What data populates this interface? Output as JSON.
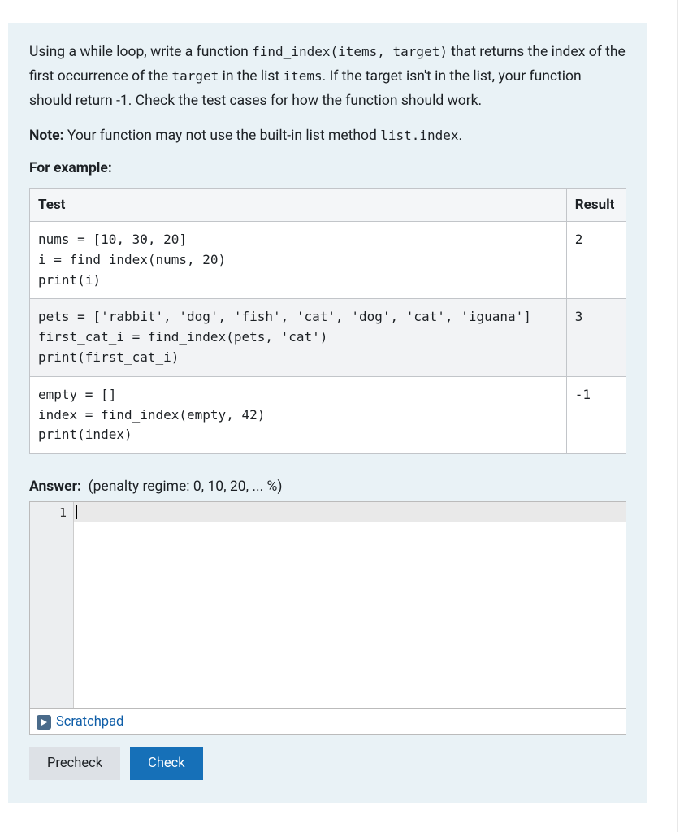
{
  "question": {
    "text_before_code1": "Using a while loop, write a function ",
    "code1": "find_index(items, target)",
    "text_mid1": " that returns the index of the first occurrence of the ",
    "code2": "target",
    "text_mid2": " in the list ",
    "code3": "items",
    "text_after": ". If the target isn't in the list, your function should return -1. Check the test cases for how the function should work."
  },
  "note": {
    "label": "Note:",
    "text_before": " Your function may not use the built-in list method ",
    "code": "list.index",
    "text_after": "."
  },
  "example_label": "For example:",
  "table": {
    "headers": {
      "test": "Test",
      "result": "Result"
    },
    "rows": [
      {
        "test": "nums = [10, 30, 20]\ni = find_index(nums, 20)\nprint(i)",
        "result": "2"
      },
      {
        "test": "pets = ['rabbit', 'dog', 'fish', 'cat', 'dog', 'cat', 'iguana']\nfirst_cat_i = find_index(pets, 'cat')\nprint(first_cat_i)",
        "result": "3"
      },
      {
        "test": "empty = []\nindex = find_index(empty, 42)\nprint(index)",
        "result": "-1"
      }
    ]
  },
  "answer": {
    "label": "Answer:",
    "regime": "(penalty regime: 0, 10, 20, ... %)"
  },
  "editor": {
    "line_number": "1"
  },
  "scratchpad": {
    "label": "Scratchpad"
  },
  "buttons": {
    "precheck": "Precheck",
    "check": "Check"
  }
}
